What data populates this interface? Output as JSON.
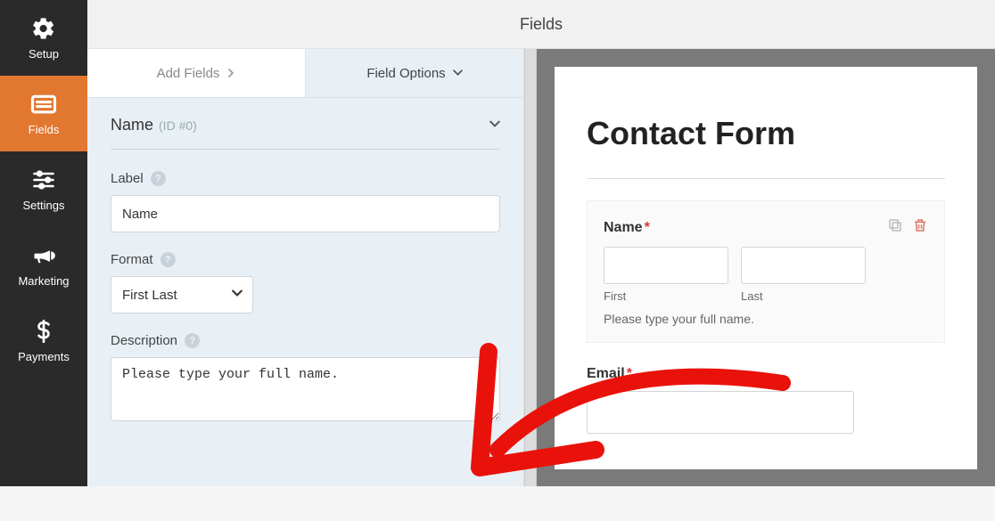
{
  "sidebar": {
    "items": [
      {
        "label": "Setup",
        "icon": "gear-icon"
      },
      {
        "label": "Fields",
        "icon": "form-icon"
      },
      {
        "label": "Settings",
        "icon": "sliders-icon"
      },
      {
        "label": "Marketing",
        "icon": "bullhorn-icon"
      },
      {
        "label": "Payments",
        "icon": "dollar-icon"
      }
    ],
    "active_index": 1
  },
  "header": {
    "title": "Fields"
  },
  "tabs": {
    "add_fields": "Add Fields",
    "field_options": "Field Options",
    "active": "field_options"
  },
  "field_options": {
    "heading_name": "Name",
    "heading_id": "(ID #0)",
    "label_label": "Label",
    "label_value": "Name",
    "format_label": "Format",
    "format_value": "First Last",
    "description_label": "Description",
    "description_value": "Please type your full name."
  },
  "preview": {
    "form_title": "Contact Form",
    "name_label": "Name",
    "required_marker": "*",
    "first_sublabel": "First",
    "last_sublabel": "Last",
    "description_text": "Please type your full name.",
    "email_label": "Email"
  }
}
